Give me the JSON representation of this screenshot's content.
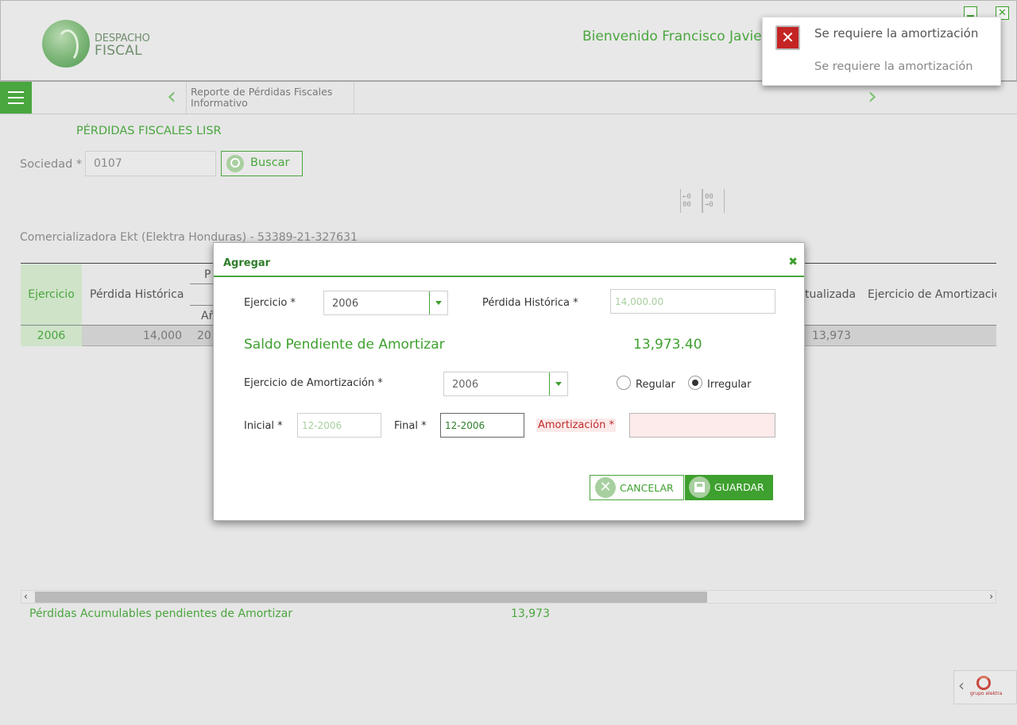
{
  "header": {
    "logo_line1": "DESPACHO",
    "logo_line2": "FISCAL",
    "welcome_label": "Bienvenido",
    "welcome_user": "Francisco Javier"
  },
  "nav": {
    "breadcrumb_line1": "Reporte de Pérdidas Fiscales",
    "breadcrumb_line2": "Informativo"
  },
  "page": {
    "title": "PÉRDIDAS FISCALES LISR",
    "sociedad_label": "Sociedad *",
    "sociedad_value": "0107",
    "search_label": "Buscar",
    "company": "Comercializadora Ekt (Elektra Honduras) - 53389-21-327631",
    "col_toggle_left": "←0 00",
    "col_toggle_right": "00 →0"
  },
  "table": {
    "headers": {
      "ejercicio": "Ejercicio",
      "perdida": "Pérdida Histórica",
      "p_partial": "P",
      "a_partial": "Añ",
      "actualizada_partial": "tualizada",
      "ejercicio_amort_partial": "Ejercicio de Amortizació"
    },
    "row": {
      "ejercicio": "2006",
      "perdida": "14,000",
      "col3_partial": "20",
      "actualizada": "13,973"
    }
  },
  "footer": {
    "label": "Pérdidas Acumulables pendientes de Amortizar",
    "value": "13,973"
  },
  "modal": {
    "title": "Agregar",
    "ejercicio_label": "Ejercicio *",
    "ejercicio_value": "2006",
    "perdida_label": "Pérdida Histórica *",
    "perdida_value": "14,000.00",
    "saldo_label": "Saldo Pendiente de Amortizar",
    "saldo_value": "13,973.40",
    "ejam_label": "Ejercicio de Amortización *",
    "ejam_value": "2006",
    "radio_regular": "Regular",
    "radio_irregular": "Irregular",
    "inicial_label": "Inicial *",
    "inicial_value": "12-2006",
    "final_label": "Final *",
    "final_value": "12-2006",
    "amortizacion_label": "Amortización *",
    "amortizacion_value": "",
    "cancel_label": "CANCELAR",
    "save_label": "GUARDAR"
  },
  "toast": {
    "title": "Se requiere la amortización",
    "message": "Se requiere la amortización"
  },
  "brand_footer": "grupo elektra",
  "colors": {
    "accent": "#4aa63e",
    "error": "#c22a2a"
  }
}
